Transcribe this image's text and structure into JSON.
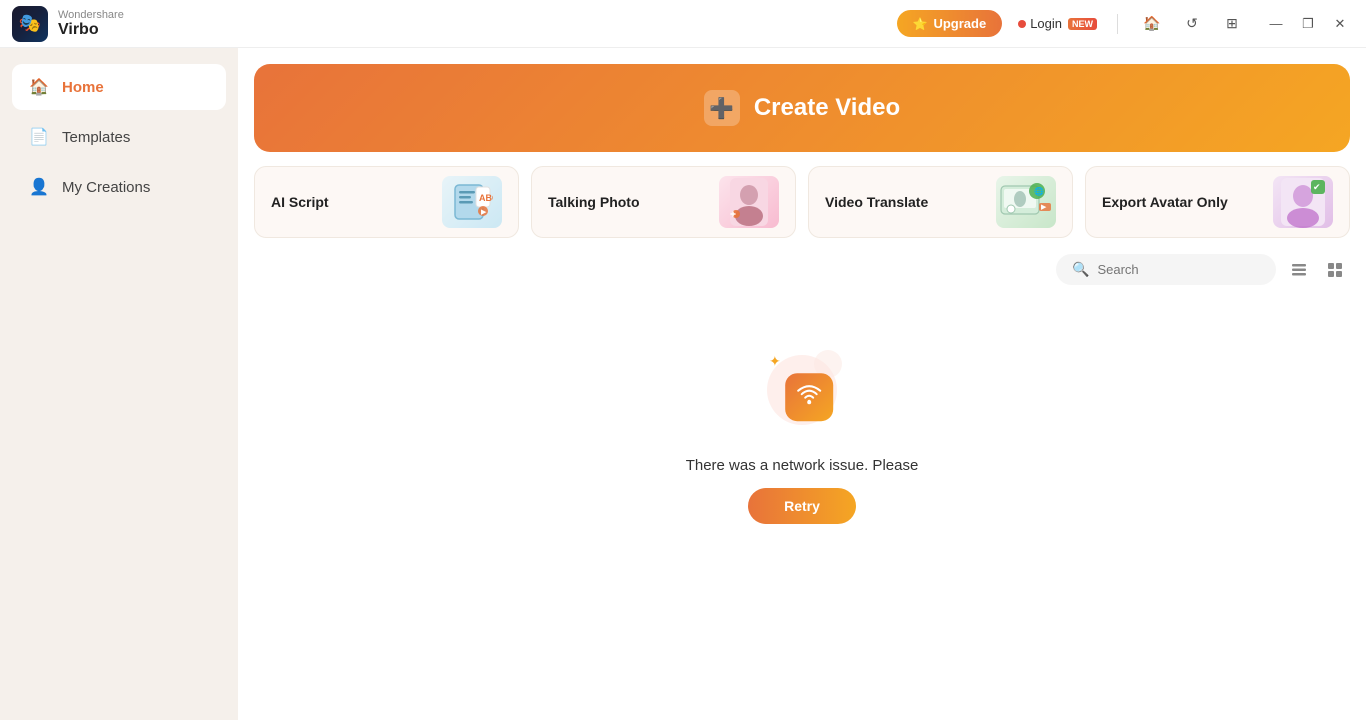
{
  "app": {
    "brand": "Wondershare",
    "name": "Virbo",
    "logo_emoji": "🎭"
  },
  "titlebar": {
    "upgrade_label": "Upgrade",
    "login_label": "Login",
    "new_badge": "NEW",
    "upgrade_star": "⭐",
    "home_icon": "🏠",
    "refresh_icon": "↺",
    "grid_icon": "⊞",
    "minimize_icon": "—",
    "restore_icon": "❐",
    "close_icon": "✕"
  },
  "sidebar": {
    "items": [
      {
        "id": "home",
        "label": "Home",
        "icon": "🏠",
        "active": true
      },
      {
        "id": "templates",
        "label": "Templates",
        "icon": "📄",
        "active": false
      },
      {
        "id": "my-creations",
        "label": "My Creations",
        "icon": "👤",
        "active": false
      }
    ]
  },
  "main": {
    "create_video": {
      "label": "Create Video",
      "icon": "➕"
    },
    "cards": [
      {
        "id": "ai-script",
        "label": "AI Script",
        "emoji": "📝"
      },
      {
        "id": "talking-photo",
        "label": "Talking Photo",
        "emoji": "👩"
      },
      {
        "id": "video-translate",
        "label": "Video Translate",
        "emoji": "🖥️"
      },
      {
        "id": "export-avatar",
        "label": "Export Avatar Only",
        "emoji": "🧑"
      }
    ],
    "search": {
      "placeholder": "Search"
    },
    "error": {
      "message": "There was a network issue. Please",
      "retry_label": "Retry"
    }
  }
}
